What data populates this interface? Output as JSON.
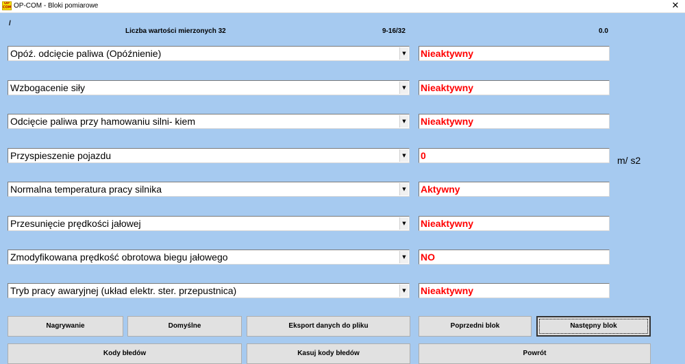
{
  "window": {
    "title": "OP-COM - Bloki pomiarowe",
    "icon_text": "OP\nCOM",
    "close_glyph": "✕"
  },
  "header": {
    "path": "/",
    "count_label": "Liczba wartości mierzonych 32",
    "range": "9-16/32",
    "time": "0.0"
  },
  "rows": [
    {
      "label": "Opóź. odcięcie paliwa (Opóźnienie)",
      "value": "Nieaktywny",
      "unit": ""
    },
    {
      "label": "Wzbogacenie siły",
      "value": "Nieaktywny",
      "unit": ""
    },
    {
      "label": "Odcięcie paliwa przy hamowaniu silni- kiem",
      "value": "Nieaktywny",
      "unit": ""
    },
    {
      "label": "Przyspieszenie pojazdu",
      "value": "0",
      "unit": "m/ s2"
    },
    {
      "label": "Normalna temperatura pracy silnika",
      "value": "Aktywny",
      "unit": ""
    },
    {
      "label": "Przesunięcie prędkości jałowej",
      "value": "Nieaktywny",
      "unit": ""
    },
    {
      "label": "Zmodyfikowana prędkość obrotowa biegu jałowego",
      "value": "NO",
      "unit": ""
    },
    {
      "label": "Tryb pracy awaryjnej (układ elektr. ster. przepustnica)",
      "value": "Nieaktywny",
      "unit": ""
    }
  ],
  "select_arrow": "▼",
  "buttons": {
    "record": "Nagrywanie",
    "defaults": "Domyślne",
    "export": "Eksport danych do pliku",
    "prev_block": "Poprzedni blok",
    "next_block": "Następny blok",
    "fault_codes": "Kody błedów",
    "clear_codes": "Kasuj kody błedów",
    "back": "Powrót"
  },
  "colors": {
    "background": "#a6caf0",
    "value_text": "#ff0000"
  }
}
